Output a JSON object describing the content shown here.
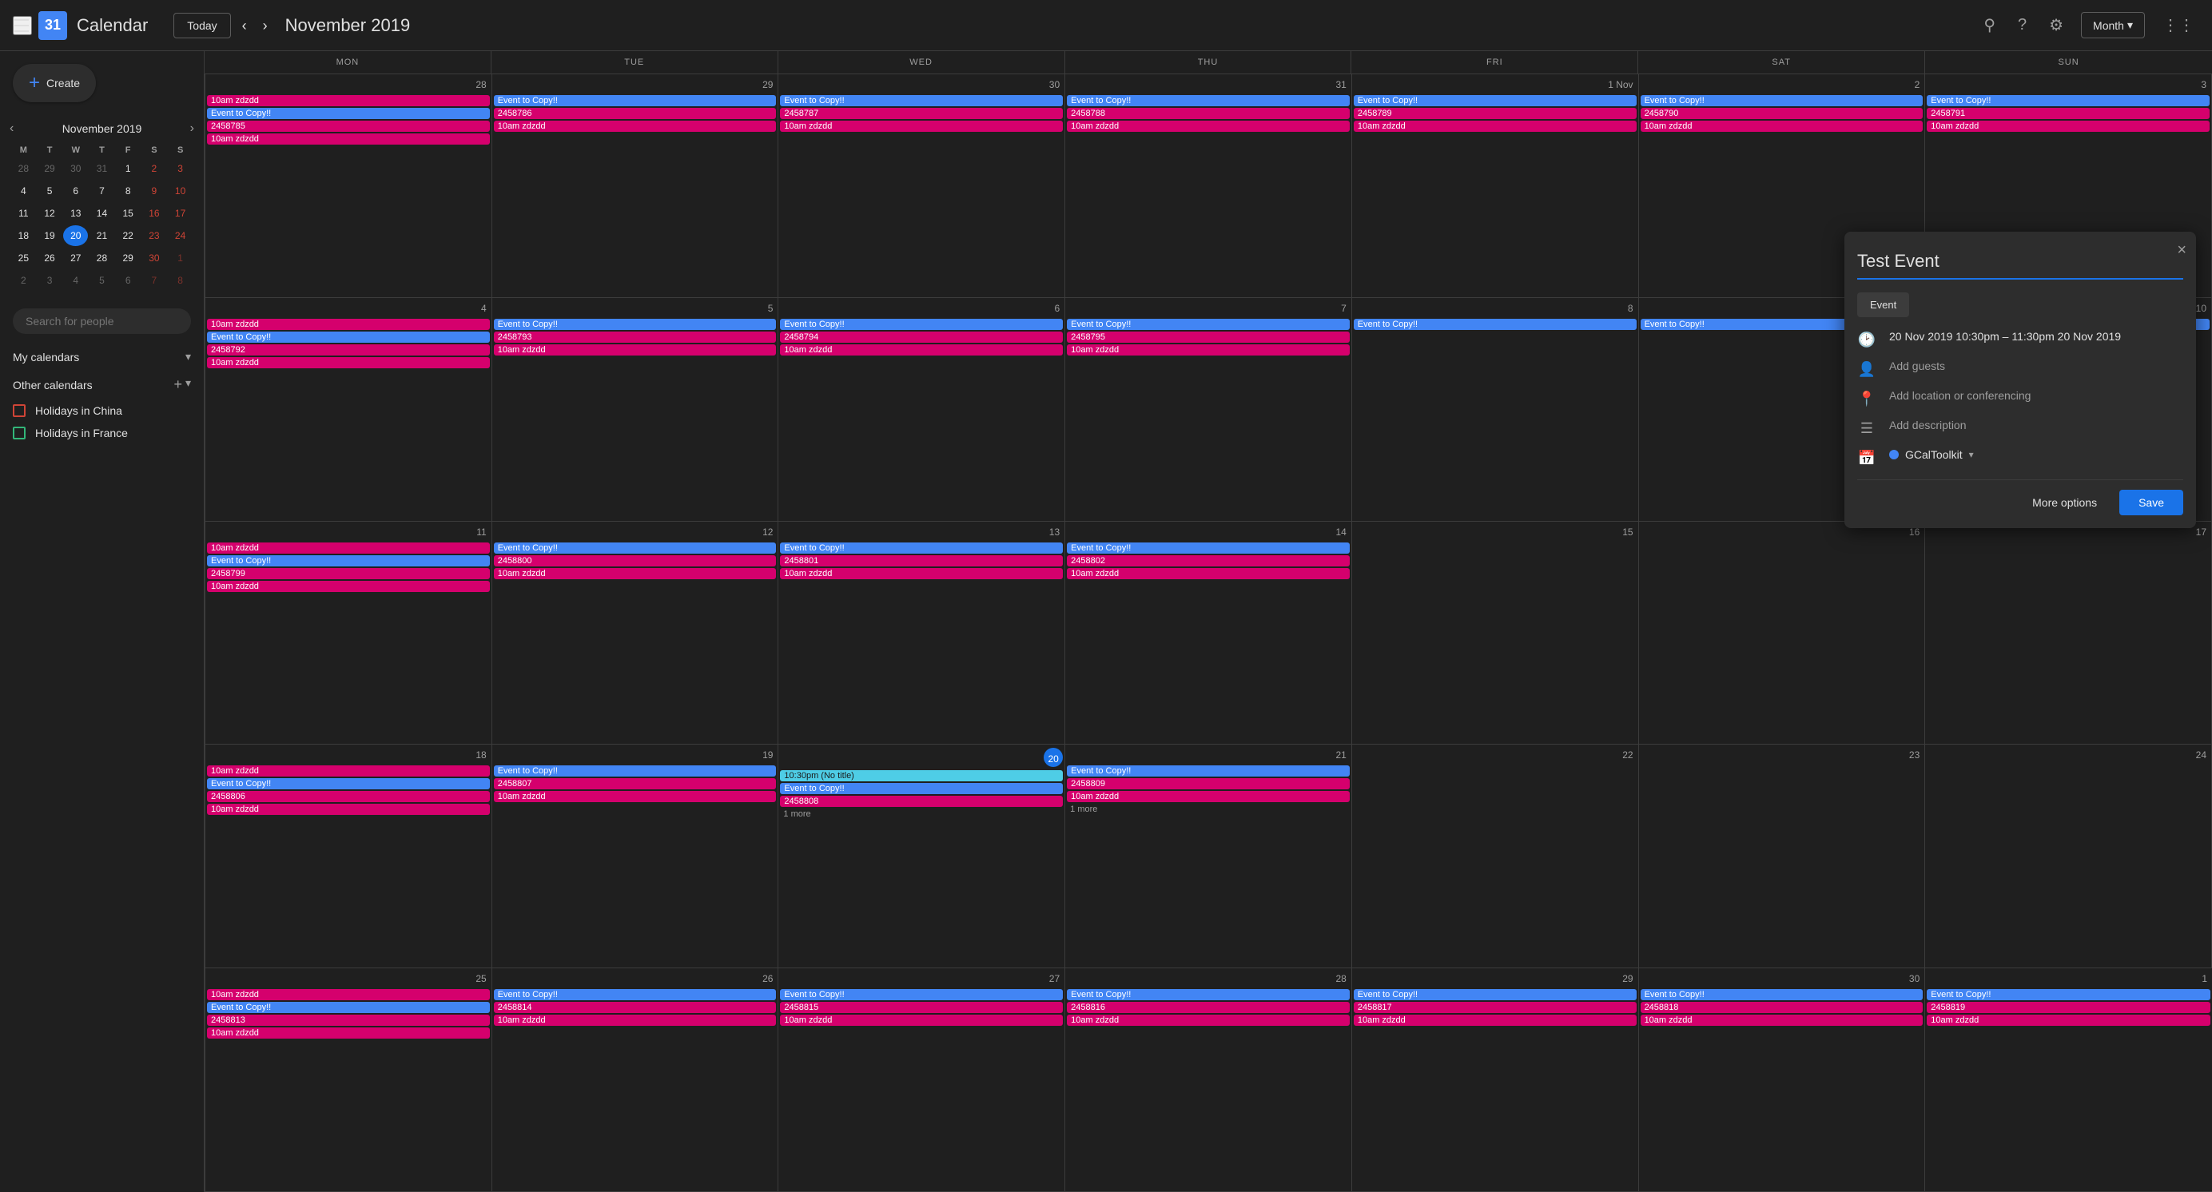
{
  "app": {
    "title": "Calendar",
    "logo_text": "31"
  },
  "topbar": {
    "today_label": "Today",
    "month_title": "November 2019",
    "view_label": "Month",
    "nav_prev": "‹",
    "nav_next": "›"
  },
  "sidebar": {
    "create_label": "Create",
    "mini_cal_title": "November 2019",
    "search_placeholder": "Search for people",
    "my_calendars_label": "My calendars",
    "other_calendars_label": "Other calendars",
    "calendars": [
      {
        "id": "china",
        "label": "Holidays in China",
        "color": "red"
      },
      {
        "id": "france",
        "label": "Holidays in France",
        "color": "green"
      }
    ]
  },
  "mini_cal": {
    "days_of_week": [
      "M",
      "T",
      "W",
      "T",
      "F",
      "S",
      "S"
    ],
    "weeks": [
      [
        {
          "d": 28,
          "other": true,
          "weekend": false
        },
        {
          "d": 29,
          "other": true,
          "weekend": false
        },
        {
          "d": 30,
          "other": true,
          "weekend": false
        },
        {
          "d": 31,
          "other": true,
          "weekend": false
        },
        {
          "d": 1,
          "other": false,
          "weekend": false
        },
        {
          "d": 2,
          "other": false,
          "weekend": true
        },
        {
          "d": 3,
          "other": false,
          "weekend": true
        }
      ],
      [
        {
          "d": 4,
          "other": false,
          "weekend": false
        },
        {
          "d": 5,
          "other": false,
          "weekend": false
        },
        {
          "d": 6,
          "other": false,
          "weekend": false
        },
        {
          "d": 7,
          "other": false,
          "weekend": false
        },
        {
          "d": 8,
          "other": false,
          "weekend": false
        },
        {
          "d": 9,
          "other": false,
          "weekend": true
        },
        {
          "d": 10,
          "other": false,
          "weekend": true
        }
      ],
      [
        {
          "d": 11,
          "other": false,
          "weekend": false
        },
        {
          "d": 12,
          "other": false,
          "weekend": false
        },
        {
          "d": 13,
          "other": false,
          "weekend": false
        },
        {
          "d": 14,
          "other": false,
          "weekend": false
        },
        {
          "d": 15,
          "other": false,
          "weekend": false
        },
        {
          "d": 16,
          "other": false,
          "weekend": true
        },
        {
          "d": 17,
          "other": false,
          "weekend": true
        }
      ],
      [
        {
          "d": 18,
          "other": false,
          "weekend": false
        },
        {
          "d": 19,
          "other": false,
          "weekend": false
        },
        {
          "d": 20,
          "other": false,
          "today": true,
          "weekend": false
        },
        {
          "d": 21,
          "other": false,
          "weekend": false
        },
        {
          "d": 22,
          "other": false,
          "weekend": false
        },
        {
          "d": 23,
          "other": false,
          "weekend": true
        },
        {
          "d": 24,
          "other": false,
          "weekend": true
        }
      ],
      [
        {
          "d": 25,
          "other": false,
          "weekend": false
        },
        {
          "d": 26,
          "other": false,
          "weekend": false
        },
        {
          "d": 27,
          "other": false,
          "weekend": false
        },
        {
          "d": 28,
          "other": false,
          "weekend": false
        },
        {
          "d": 29,
          "other": false,
          "weekend": false
        },
        {
          "d": 30,
          "other": false,
          "weekend": true
        },
        {
          "d": 1,
          "other": true,
          "weekend": true
        }
      ],
      [
        {
          "d": 2,
          "other": true,
          "weekend": false
        },
        {
          "d": 3,
          "other": true,
          "weekend": false
        },
        {
          "d": 4,
          "other": true,
          "weekend": false
        },
        {
          "d": 5,
          "other": true,
          "weekend": false
        },
        {
          "d": 6,
          "other": true,
          "weekend": false
        },
        {
          "d": 7,
          "other": true,
          "weekend": true
        },
        {
          "d": 8,
          "other": true,
          "weekend": true
        }
      ]
    ]
  },
  "calendar": {
    "headers": [
      "MON",
      "TUE",
      "WED",
      "THU",
      "FRI",
      "SAT",
      "SUN"
    ],
    "weeks": [
      {
        "days": [
          {
            "num": "28",
            "events": [
              {
                "label": "10am zdzdd",
                "type": "pink"
              },
              {
                "label": "Event to Copy!!",
                "type": "blue"
              },
              {
                "label": "2458785",
                "type": "pink"
              },
              {
                "label": "10am zdzdd",
                "type": "pink"
              }
            ]
          },
          {
            "num": "29",
            "events": [
              {
                "label": "Event to Copy!!",
                "type": "blue"
              },
              {
                "label": "2458786",
                "type": "pink"
              },
              {
                "label": "10am zdzdd",
                "type": "pink"
              }
            ]
          },
          {
            "num": "30",
            "events": [
              {
                "label": "Event to Copy!!",
                "type": "blue"
              },
              {
                "label": "2458787",
                "type": "pink"
              },
              {
                "label": "10am zdzdd",
                "type": "pink"
              }
            ]
          },
          {
            "num": "31",
            "events": [
              {
                "label": "Event to Copy!!",
                "type": "blue"
              },
              {
                "label": "2458788",
                "type": "pink"
              },
              {
                "label": "10am zdzdd",
                "type": "pink"
              }
            ]
          },
          {
            "num": "1 Nov",
            "events": [
              {
                "label": "Event to Copy!!",
                "type": "blue"
              },
              {
                "label": "2458789",
                "type": "pink"
              },
              {
                "label": "10am zdzdd",
                "type": "pink"
              }
            ]
          },
          {
            "num": "2",
            "events": [
              {
                "label": "Event to Copy!!",
                "type": "blue"
              },
              {
                "label": "2458790",
                "type": "pink"
              },
              {
                "label": "10am zdzdd",
                "type": "pink"
              }
            ]
          },
          {
            "num": "3",
            "events": [
              {
                "label": "Event to Copy!!",
                "type": "blue"
              },
              {
                "label": "2458791",
                "type": "pink"
              },
              {
                "label": "10am zdzdd",
                "type": "pink"
              }
            ]
          }
        ]
      },
      {
        "days": [
          {
            "num": "4",
            "events": [
              {
                "label": "10am zdzdd",
                "type": "pink"
              },
              {
                "label": "Event to Copy!!",
                "type": "blue"
              },
              {
                "label": "2458792",
                "type": "pink"
              },
              {
                "label": "10am zdzdd",
                "type": "pink"
              }
            ]
          },
          {
            "num": "5",
            "events": [
              {
                "label": "Event to Copy!!",
                "type": "blue"
              },
              {
                "label": "2458793",
                "type": "pink"
              },
              {
                "label": "10am zdzdd",
                "type": "pink"
              }
            ]
          },
          {
            "num": "6",
            "events": [
              {
                "label": "Event to Copy!!",
                "type": "blue"
              },
              {
                "label": "2458794",
                "type": "pink"
              },
              {
                "label": "10am zdzdd",
                "type": "pink"
              }
            ]
          },
          {
            "num": "7",
            "events": [
              {
                "label": "Event to Copy!!",
                "type": "blue"
              },
              {
                "label": "2458795",
                "type": "pink"
              },
              {
                "label": "10am zdzdd",
                "type": "pink"
              }
            ]
          },
          {
            "num": "8",
            "events": [
              {
                "label": "Event to Copy!!",
                "type": "blue"
              },
              {
                "label": "",
                "type": "blue"
              },
              {
                "label": "",
                "type": "pink"
              }
            ]
          },
          {
            "num": "9",
            "events": [
              {
                "label": "Event to Copy!!",
                "type": "blue"
              },
              {
                "label": "",
                "type": "blue"
              },
              {
                "label": "",
                "type": "pink"
              }
            ]
          },
          {
            "num": "10",
            "events": [
              {
                "label": "Event to Copy!!",
                "type": "blue"
              },
              {
                "label": "",
                "type": "pink"
              },
              {
                "label": "",
                "type": "pink"
              }
            ]
          }
        ]
      },
      {
        "days": [
          {
            "num": "11",
            "events": [
              {
                "label": "10am zdzdd",
                "type": "pink"
              },
              {
                "label": "Event to Copy!!",
                "type": "blue"
              },
              {
                "label": "2458799",
                "type": "pink"
              },
              {
                "label": "10am zdzdd",
                "type": "pink"
              }
            ]
          },
          {
            "num": "12",
            "events": [
              {
                "label": "Event to Copy!!",
                "type": "blue"
              },
              {
                "label": "2458800",
                "type": "pink"
              },
              {
                "label": "10am zdzdd",
                "type": "pink"
              }
            ]
          },
          {
            "num": "13",
            "events": [
              {
                "label": "Event to Copy!!",
                "type": "blue"
              },
              {
                "label": "2458801",
                "type": "pink"
              },
              {
                "label": "10am zdzdd",
                "type": "pink"
              }
            ]
          },
          {
            "num": "14",
            "events": [
              {
                "label": "Event to Copy!!",
                "type": "blue"
              },
              {
                "label": "2458802",
                "type": "pink"
              },
              {
                "label": "10am zdzdd",
                "type": "pink"
              }
            ]
          },
          {
            "num": "15",
            "events": []
          },
          {
            "num": "16",
            "events": []
          },
          {
            "num": "17",
            "events": []
          }
        ]
      },
      {
        "days": [
          {
            "num": "18",
            "events": [
              {
                "label": "10am zdzdd",
                "type": "pink"
              },
              {
                "label": "Event to Copy!!",
                "type": "blue"
              },
              {
                "label": "2458806",
                "type": "pink"
              },
              {
                "label": "10am zdzdd",
                "type": "pink"
              }
            ]
          },
          {
            "num": "19",
            "events": [
              {
                "label": "Event to Copy!!",
                "type": "blue"
              },
              {
                "label": "2458807",
                "type": "pink"
              },
              {
                "label": "10am zdzdd",
                "type": "pink"
              }
            ]
          },
          {
            "num": "20",
            "today": true,
            "events": [
              {
                "label": "10:30pm (No title)",
                "type": "light"
              },
              {
                "label": "Event to Copy!!",
                "type": "blue"
              },
              {
                "label": "2458808",
                "type": "pink"
              },
              {
                "label": "",
                "type": ""
              }
            ],
            "more": "1 more"
          },
          {
            "num": "21",
            "events": [
              {
                "label": "Event to Copy!!",
                "type": "blue"
              },
              {
                "label": "2458809",
                "type": "pink"
              },
              {
                "label": "10am zdzdd",
                "type": "pink"
              }
            ],
            "more": "1 more"
          },
          {
            "num": "22",
            "events": []
          },
          {
            "num": "23",
            "events": []
          },
          {
            "num": "24",
            "events": []
          }
        ]
      },
      {
        "days": [
          {
            "num": "25",
            "events": [
              {
                "label": "10am zdzdd",
                "type": "pink"
              },
              {
                "label": "Event to Copy!!",
                "type": "blue"
              },
              {
                "label": "2458813",
                "type": "pink"
              },
              {
                "label": "10am zdzdd",
                "type": "pink"
              }
            ]
          },
          {
            "num": "26",
            "events": [
              {
                "label": "Event to Copy!!",
                "type": "blue"
              },
              {
                "label": "2458814",
                "type": "pink"
              },
              {
                "label": "10am zdzdd",
                "type": "pink"
              }
            ]
          },
          {
            "num": "27",
            "events": [
              {
                "label": "Event to Copy!!",
                "type": "blue"
              },
              {
                "label": "2458815",
                "type": "pink"
              },
              {
                "label": "10am zdzdd",
                "type": "pink"
              }
            ]
          },
          {
            "num": "28",
            "events": [
              {
                "label": "Event to Copy!!",
                "type": "blue"
              },
              {
                "label": "2458816",
                "type": "pink"
              },
              {
                "label": "10am zdzdd",
                "type": "pink"
              }
            ]
          },
          {
            "num": "29",
            "events": [
              {
                "label": "Event to Copy!!",
                "type": "blue"
              },
              {
                "label": "2458817",
                "type": "pink"
              },
              {
                "label": "10am zdzdd",
                "type": "pink"
              }
            ]
          },
          {
            "num": "30",
            "events": [
              {
                "label": "Event to Copy!!",
                "type": "blue"
              },
              {
                "label": "2458818",
                "type": "pink"
              },
              {
                "label": "10am zdzdd",
                "type": "pink"
              }
            ]
          },
          {
            "num": "1",
            "events": [
              {
                "label": "Event to Copy!!",
                "type": "blue"
              },
              {
                "label": "2458819",
                "type": "pink"
              },
              {
                "label": "10am zdzdd",
                "type": "pink"
              }
            ]
          }
        ]
      }
    ]
  },
  "popup": {
    "close_label": "×",
    "title_placeholder": "Test Event",
    "type_label": "Event",
    "datetime": "20 Nov 2019   10:30pm – 11:30pm   20 Nov 2019",
    "guests_placeholder": "Add guests",
    "location_placeholder": "Add location or conferencing",
    "description_placeholder": "Add description",
    "calendar_name": "GCalToolkit",
    "more_options_label": "More options",
    "save_label": "Save"
  }
}
